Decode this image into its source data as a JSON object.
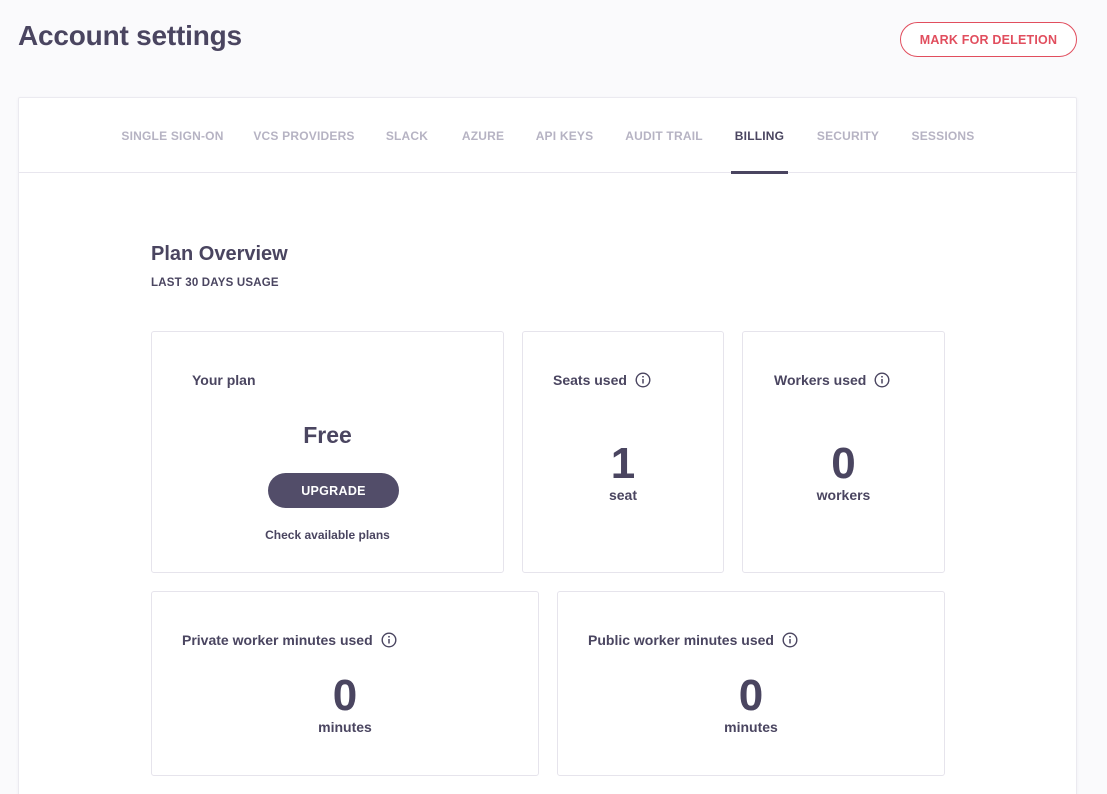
{
  "header": {
    "title": "Account settings",
    "delete_label": "MARK FOR DELETION"
  },
  "tabs": [
    {
      "label": "SINGLE SIGN-ON",
      "active": false
    },
    {
      "label": "VCS PROVIDERS",
      "active": false
    },
    {
      "label": "SLACK",
      "active": false
    },
    {
      "label": "AZURE",
      "active": false
    },
    {
      "label": "API KEYS",
      "active": false
    },
    {
      "label": "AUDIT TRAIL",
      "active": false
    },
    {
      "label": "BILLING",
      "active": true
    },
    {
      "label": "SECURITY",
      "active": false
    },
    {
      "label": "SESSIONS",
      "active": false
    }
  ],
  "overview": {
    "title": "Plan Overview",
    "subtitle": "LAST 30 DAYS USAGE"
  },
  "plan_card": {
    "label": "Your plan",
    "plan": "Free",
    "upgrade_label": "UPGRADE",
    "link_label": "Check available plans"
  },
  "seats_card": {
    "label": "Seats used",
    "icon": "info-icon",
    "value": "1",
    "unit": "seat"
  },
  "workers_card": {
    "label": "Workers used",
    "icon": "info-icon",
    "value": "0",
    "unit": "workers"
  },
  "private_minutes_card": {
    "label": "Private worker minutes used",
    "icon": "info-icon",
    "value": "0",
    "unit": "minutes"
  },
  "public_minutes_card": {
    "label": "Public worker minutes used",
    "icon": "info-icon",
    "value": "0",
    "unit": "minutes"
  },
  "colors": {
    "primary": "#4a4560",
    "button": "#524d69",
    "danger": "#e14e5e",
    "tab_inactive": "#b6b3c3"
  }
}
